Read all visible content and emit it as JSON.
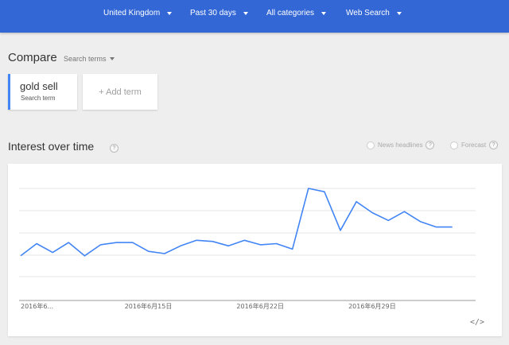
{
  "topbar": {
    "filters": [
      {
        "label": "United Kingdom"
      },
      {
        "label": "Past 30 days"
      },
      {
        "label": "All categories"
      },
      {
        "label": "Web Search"
      }
    ]
  },
  "compare": {
    "title": "Compare",
    "selector_label": "Search terms"
  },
  "terms": [
    {
      "name": "gold sell",
      "sublabel": "Search term",
      "color": "#4285f4"
    }
  ],
  "add_term": {
    "label": "+ Add term"
  },
  "interest": {
    "title": "Interest over time",
    "help": "?",
    "options": [
      {
        "label": "News headlines"
      },
      {
        "label": "Forecast"
      }
    ],
    "embed_label": "</>"
  },
  "chart_data": {
    "type": "line",
    "title": "",
    "xlabel": "",
    "ylabel": "",
    "x_tick_labels": [
      "2016年6...",
      "2016年6月15日",
      "2016年6月22日",
      "2016年6月29日"
    ],
    "x_tick_index": [
      0,
      7,
      14,
      21
    ],
    "ylim": [
      0,
      100
    ],
    "grid": true,
    "series": [
      {
        "color": "#4285f4",
        "values": [
          39,
          50,
          42,
          51,
          39,
          49,
          51,
          51,
          43,
          41,
          48,
          53,
          52,
          48,
          53,
          49,
          50,
          45,
          100,
          97,
          62,
          88,
          78,
          71,
          79,
          70,
          65,
          65
        ]
      }
    ]
  }
}
